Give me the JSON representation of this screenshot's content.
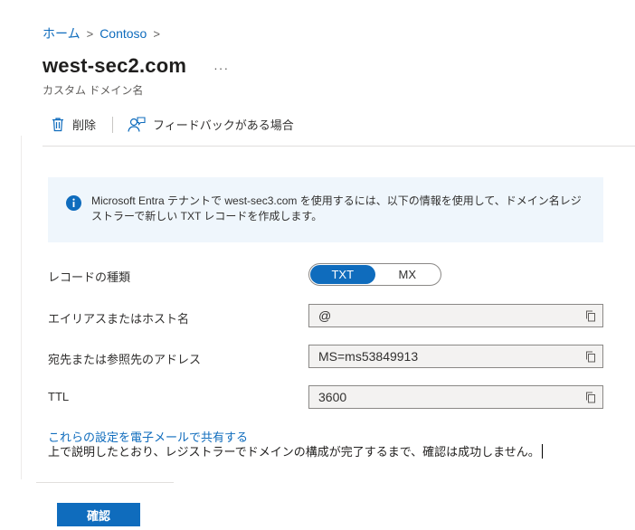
{
  "breadcrumb": [
    {
      "label": "ホーム"
    },
    {
      "label": "Contoso"
    }
  ],
  "breadcrumb_separator": ">",
  "page": {
    "title": "west-sec2.com",
    "more_label": "···",
    "subtitle": "カスタム ドメイン名"
  },
  "toolbar": {
    "delete_label": "削除",
    "feedback_label": "フィードバックがある場合"
  },
  "info": {
    "icon": "info-icon",
    "text": "Microsoft Entra テナントで west-sec3.com を使用するには、以下の情報を使用して、ドメイン名レジストラーで新しい TXT レコードを作成します。"
  },
  "record_type": {
    "label": "レコードの種類",
    "options": [
      "TXT",
      "MX"
    ],
    "selected": "TXT"
  },
  "fields": {
    "alias": {
      "label": "エイリアスまたはホスト名",
      "value": "@"
    },
    "destination": {
      "label": "宛先または参照先のアドレス",
      "value": "MS=ms53849913"
    },
    "ttl": {
      "label": "TTL",
      "value": "3600"
    }
  },
  "share_link": "これらの設定を電子メールで共有する",
  "note": "上で説明したとおり、レジストラーでドメインの構成が完了するまで、確認は成功しません。",
  "confirm_label": "確認",
  "colors": {
    "accent": "#0f6cbd",
    "info_background": "#eff6fc",
    "field_background": "#f3f2f1"
  }
}
